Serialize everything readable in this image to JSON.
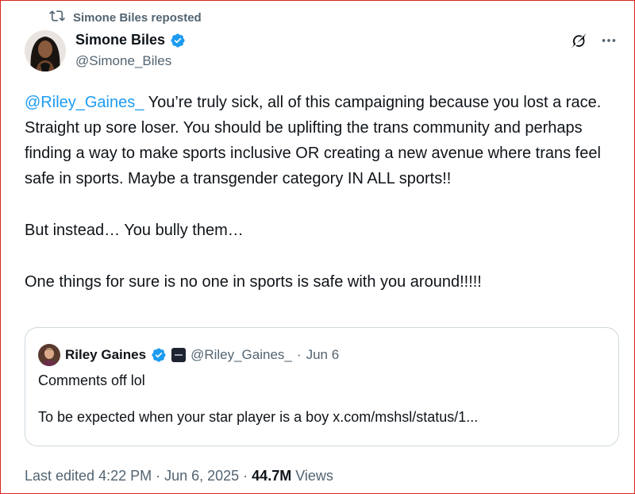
{
  "repost": {
    "text": "Simone Biles reposted"
  },
  "author": {
    "name": "Simone Biles",
    "handle": "@Simone_Biles"
  },
  "tweet": {
    "mention": "@Riley_Gaines_",
    "p1_rest": " You’re truly sick, all of this campaigning because you lost a race. Straight up sore loser. You should be uplifting the trans community and perhaps finding a way to make sports inclusive OR creating a new avenue where trans feel safe in sports. Maybe a transgender category IN ALL sports!!",
    "p2": "But instead… You bully them…",
    "p3": "One things for sure is no one in sports is safe with you around!!!!!"
  },
  "quote": {
    "name": "Riley Gaines",
    "handle": "@Riley_Gaines_",
    "separator": "·",
    "date": "Jun 6",
    "line1": "Comments off lol",
    "line2": "To be expected when your star player is a boy x.com/mshsl/status/1..."
  },
  "footer": {
    "edited": "Last edited 4:22 PM · Jun 6, 2025 · ",
    "views_count": "44.7M",
    "views_label": " Views"
  },
  "colors": {
    "link": "#1d9bf0",
    "verified": "#1d9bf0",
    "muted": "#536471",
    "text": "#0f1419",
    "border": "#cfd9de",
    "frame": "#d8241c"
  },
  "icons": [
    "repost-icon",
    "verified-badge-icon",
    "grok-icon",
    "more-icon",
    "affiliate-badge-icon"
  ]
}
